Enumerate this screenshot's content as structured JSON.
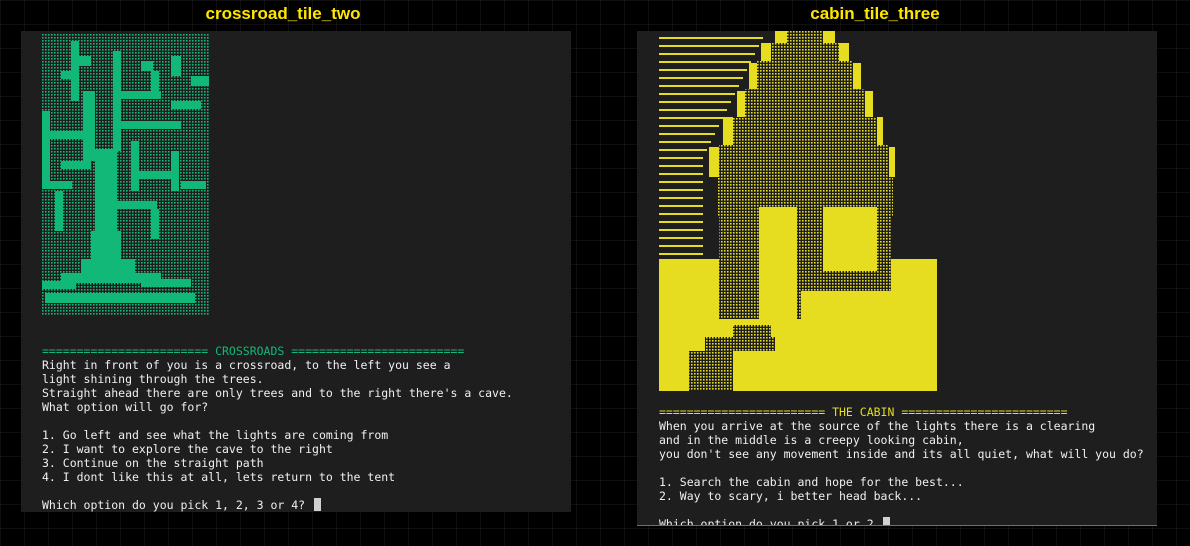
{
  "left_panel": {
    "title": "crossroad_tile_two",
    "art": "tree-pixel-art",
    "art_color": "#12b877",
    "banner": "======================== CROSSROADS =========================",
    "story": [
      "Right in front of you is a crossroad, to the left you see a",
      "light shining through the trees.",
      "Straight ahead there are only trees and to the right there's a cave.",
      "What option will go for?"
    ],
    "options": [
      "1. Go left and see what the lights are coming from",
      "2. I want to explore the cave to the right",
      "3. Continue on the straight path",
      "4. I dont like this at all, lets return to the tent"
    ],
    "prompt": "Which option do you pick 1, 2, 3 or 4? "
  },
  "right_panel": {
    "title": "cabin_tile_three",
    "art": "cabin-pixel-art",
    "art_color": "#e6dc20",
    "banner": "======================== THE CABIN ========================",
    "story": [
      "When you arrive at the source of the lights there is a clearing",
      "and in the middle is a creepy looking cabin,",
      "you don't see any movement inside and its all quiet, what will you do?"
    ],
    "options": [
      "1. Search the cabin and hope for the best...",
      "2. Way to scary, i better head back..."
    ],
    "prompt": "Which option do you pick 1 or 2 "
  },
  "colors": {
    "title": "#ffe600",
    "terminal_bg": "#1e1e1e",
    "terminal_text": "#f0f0f0"
  }
}
